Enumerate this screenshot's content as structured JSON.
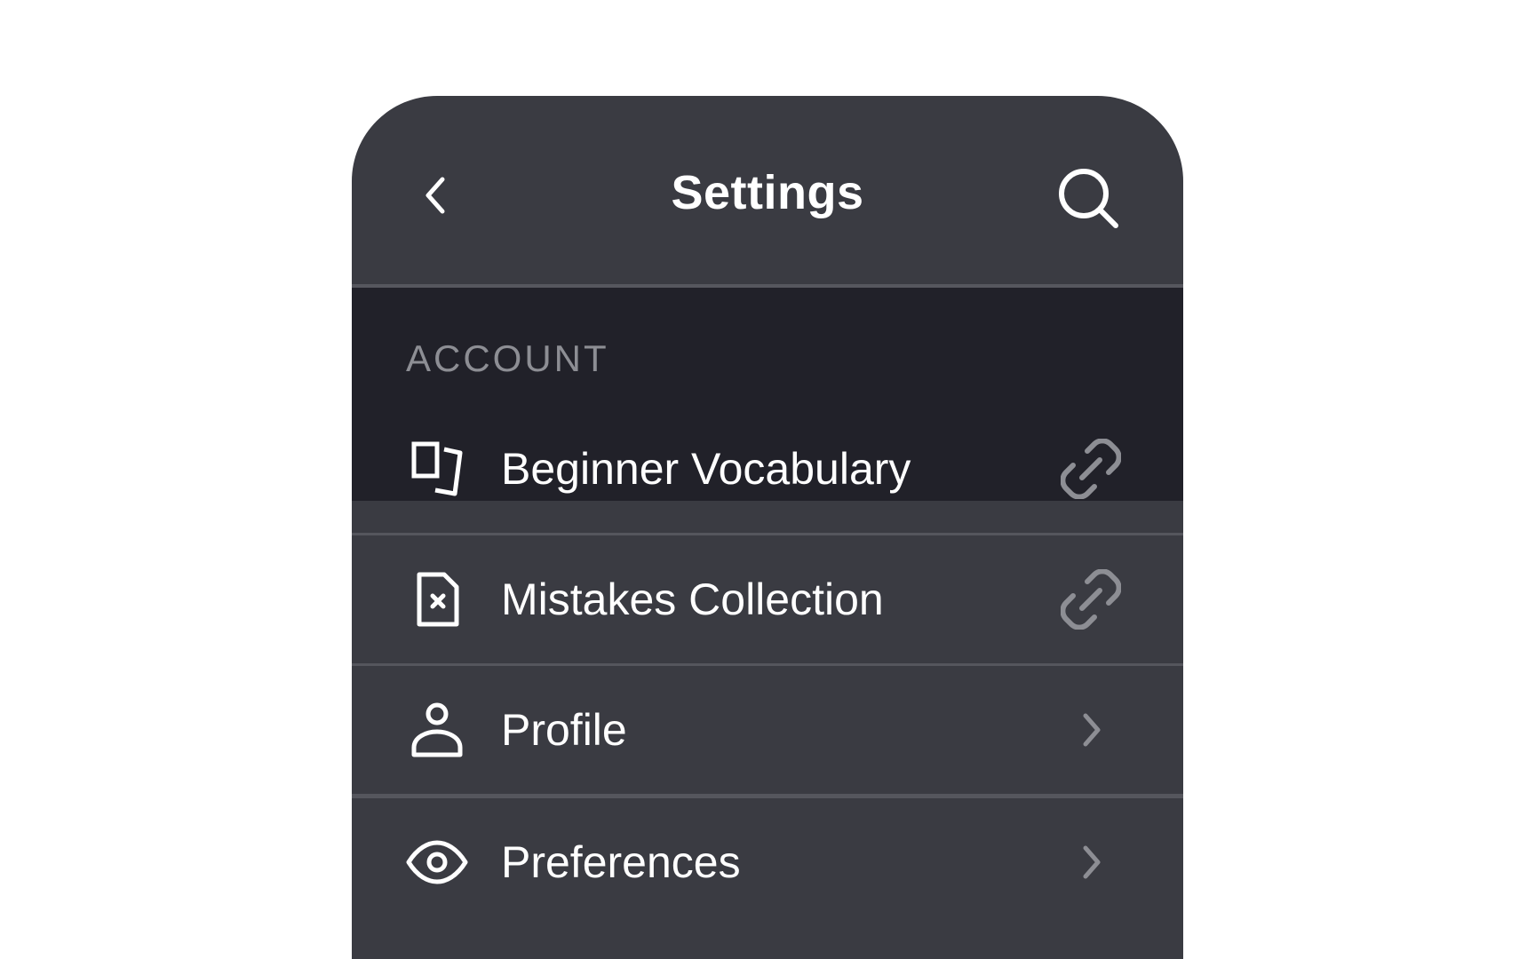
{
  "header": {
    "title": "Settings",
    "back_icon": "chevron-left-icon",
    "search_icon": "search-icon"
  },
  "section": {
    "label": "ACCOUNT"
  },
  "rows": [
    {
      "label": "Beginner Vocabulary",
      "icon": "flashcards-icon",
      "trail": "link-icon"
    },
    {
      "label": "Mistakes Collection",
      "icon": "file-x-icon",
      "trail": "link-icon"
    },
    {
      "label": "Profile",
      "icon": "user-icon",
      "trail": "chevron-right-icon"
    },
    {
      "label": "Preferences",
      "icon": "eye-icon",
      "trail": "chevron-right-icon"
    }
  ],
  "colors": {
    "panel": "#3a3b42",
    "section_band": "#212129",
    "divider": "#55565d",
    "text": "#ffffff",
    "muted": "#8d8e94"
  }
}
